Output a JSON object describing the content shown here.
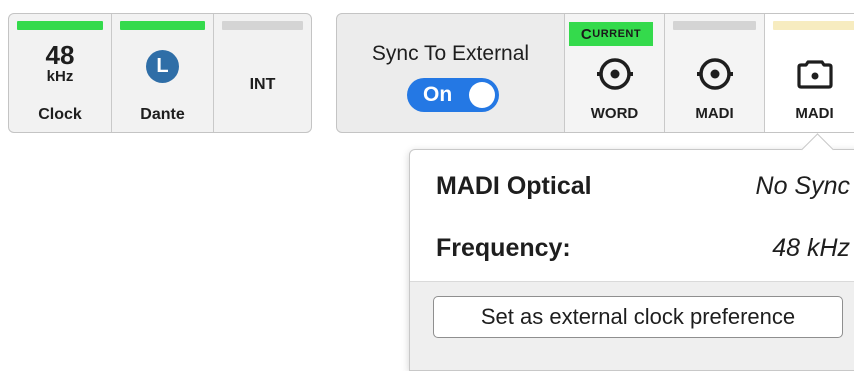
{
  "clock_panel": {
    "clock": {
      "value": "48",
      "unit": "kHz",
      "label": "Clock",
      "bar_color": "#34da4c"
    },
    "dante": {
      "badge": "L",
      "label": "Dante",
      "bar_color": "#34da4c",
      "badge_color": "#2f6ea7"
    },
    "int": {
      "label": "INT",
      "bar_color": "#d4d4d4"
    }
  },
  "sync_panel": {
    "title": "Sync To External",
    "toggle": {
      "label": "On",
      "state": true,
      "color": "#2478e4"
    },
    "sources": [
      {
        "label": "WORD",
        "badge": "Current",
        "icon": "bnc-connector-icon",
        "bar_color": "#34da4c"
      },
      {
        "label": "MADI",
        "icon": "bnc-connector-icon",
        "bar_color": "#d4d4d4"
      },
      {
        "label": "MADI",
        "icon": "optical-connector-icon",
        "bar_color": "#f7ecc0"
      }
    ]
  },
  "popover": {
    "title": "MADI Optical",
    "status": "No Sync",
    "frequency_label": "Frequency:",
    "frequency_value": "48 kHz",
    "button_label": "Set as external clock preference"
  }
}
